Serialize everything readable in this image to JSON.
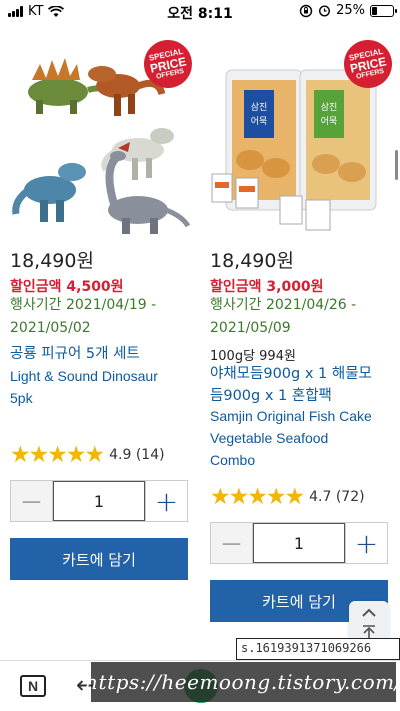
{
  "status_bar": {
    "carrier": "KT",
    "time": "오전 8:11",
    "battery": "25%",
    "battery_level": 0.25
  },
  "products": [
    {
      "badge": {
        "line1": "SPECIAL",
        "line2": "PRICE",
        "line3": "OFFERS"
      },
      "price": "18,490원",
      "discount": "할인금액 4,500원",
      "period_line1": "행사기간 2021/04/19 -",
      "period_line2": "2021/05/02",
      "name_ko": "공룡 피규어 5개 세트",
      "name_en_line1": "Light & Sound Dinosaur",
      "name_en_line2": "5pk",
      "stars": "★★★★★",
      "rating": "4.9 (14)",
      "qty": "1",
      "cart_label": "카트에 담기"
    },
    {
      "badge": {
        "line1": "SPECIAL",
        "line2": "PRICE",
        "line3": "OFFERS"
      },
      "price": "18,490원",
      "discount": "할인금액 3,000원",
      "period_line1": "행사기간 2021/04/26 -",
      "period_line2": "2021/05/09",
      "unit_price": "100g당 994원",
      "name_ko_line1": "야채모듬900g x 1 해물모",
      "name_ko_line2": "듬900g x 1 혼합팩",
      "name_en_line1": "Samjin Original Fish Cake",
      "name_en_line2": "Vegetable Seafood",
      "name_en_line3": "Combo",
      "stars": "★★★★★",
      "rating": "4.7 (72)",
      "qty": "1",
      "cart_label": "카트에 담기"
    }
  ],
  "sku_text": "s.1619391371069266",
  "watermark": "https://heemoong.tistory.com/",
  "nav": {
    "n_label": "N",
    "back_glyph": "←"
  },
  "colors": {
    "accent_blue": "#2262a8",
    "discount_red": "#d42032",
    "period_green": "#3a7a2a",
    "star": "#f2b705"
  }
}
